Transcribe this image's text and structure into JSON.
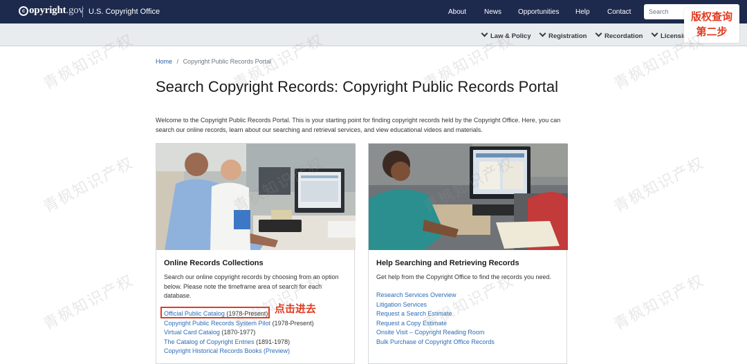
{
  "header": {
    "logo_mark": "c",
    "logo_word": "opyright",
    "logo_gov": ".gov",
    "office": "U.S. Copyright Office",
    "nav": [
      "About",
      "News",
      "Opportunities",
      "Help",
      "Contact"
    ],
    "search_placeholder": "Search"
  },
  "subnav": [
    "Law & Policy",
    "Registration",
    "Recordation",
    "Licensin"
  ],
  "annotation": {
    "step_line1": "版权查询",
    "step_line2": "第二步",
    "click_label": "点击进去"
  },
  "breadcrumb": {
    "home": "Home",
    "separator": "/",
    "current": "Copyright Public Records Portal"
  },
  "page_title": "Search Copyright Records: Copyright Public Records Portal",
  "intro": "Welcome to the Copyright Public Records Portal. This is your starting point for finding copyright records held by the Copyright Office. Here, you can search our online records, learn about our searching and retrieval services, and view educational videos and materials.",
  "cards": [
    {
      "title": "Online Records Collections",
      "description": "Search our online copyright records by choosing from an option below. Please note the timeframe area of search for each database.",
      "links": [
        {
          "label": "Official Public Catalog",
          "suffix": " (1978-Present)"
        },
        {
          "label": "Copyright Public Records System Pilot",
          "suffix": " (1978-Present)"
        },
        {
          "label": "Virtual Card Catalog",
          "suffix": " (1870-1977)"
        },
        {
          "label": "The Catalog of Copyright Entries",
          "suffix": " (1891-1978)"
        },
        {
          "label": "Copyright Historical Records Books (Preview)",
          "suffix": ""
        }
      ]
    },
    {
      "title": "Help Searching and Retrieving Records",
      "description": "Get help from the Copyright Office to find the records you need.",
      "links": [
        {
          "label": "Research Services Overview"
        },
        {
          "label": "Litigation Services"
        },
        {
          "label": "Request a Search Estimate"
        },
        {
          "label": "Request a Copy Estimate"
        },
        {
          "label": "Onsite Visit – Copyright Reading Room"
        },
        {
          "label": "Bulk Purchase of Copyright Office Records"
        }
      ]
    }
  ],
  "watermark": "青枫知识产权"
}
